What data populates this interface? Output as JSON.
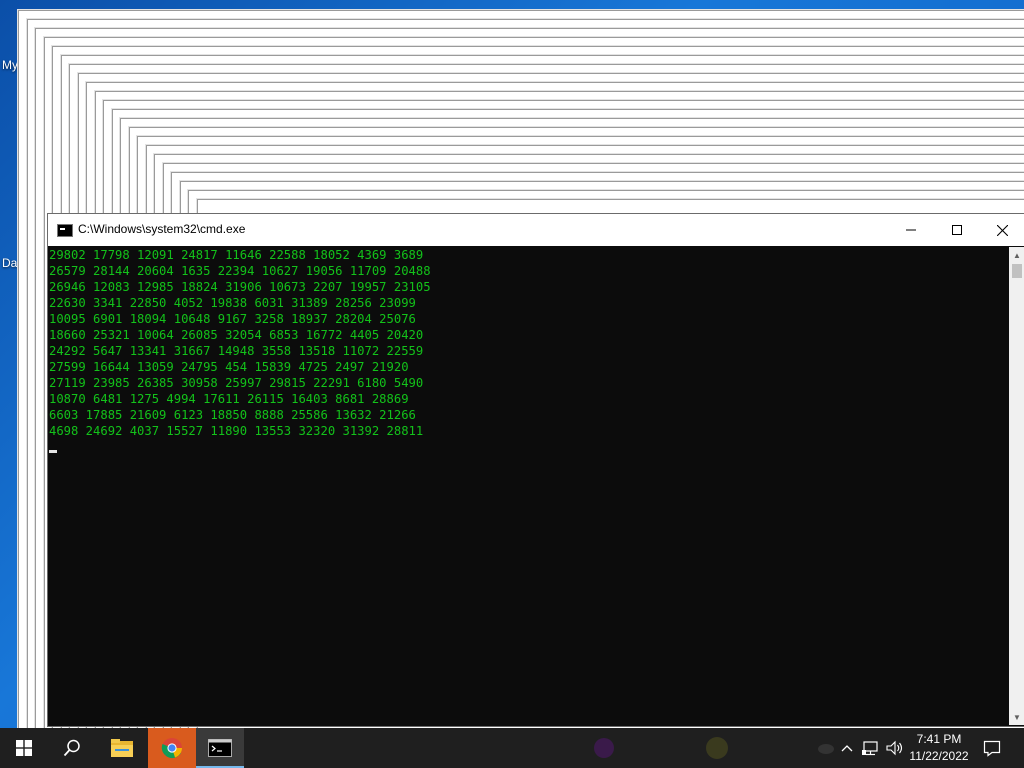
{
  "desktop": {
    "icon_labels": [
      "My",
      "Da"
    ]
  },
  "cmd_window": {
    "title": "C:\\Windows\\system32\\cmd.exe",
    "minimize_icon": "minimize-icon",
    "maximize_icon": "maximize-icon",
    "close_icon": "close-icon",
    "output_lines": [
      "29802 17798 12091 24817 11646 22588 18052 4369 3689",
      "26579 28144 20604 1635 22394 10627 19056 11709 20488",
      "26946 12083 12985 18824 31906 10673 2207 19957 23105",
      "22630 3341 22850 4052 19838 6031 31389 28256 23099",
      "10095 6901 18094 10648 9167 3258 18937 28204 25076",
      "18660 25321 10064 26085 32054 6853 16772 4405 20420",
      "24292 5647 13341 31667 14948 3558 13518 11072 22559",
      "27599 16644 13059 24795 454 15839 4725 2497 21920",
      "27119 23985 26385 30958 25997 29815 22291 6180 5490",
      "10870 6481 1275 4994 17611 26115 16403 8681 28869",
      "6603 17885 21609 6123 18850 8888 25586 13632 21266",
      "4698 24692 4037 15527 11890 13553 32320 31392 28811"
    ],
    "text_color": "#13c21a"
  },
  "taskbar": {
    "start_icon": "windows-start-icon",
    "search_icon": "search-icon",
    "apps": [
      "file-explorer-icon",
      "chrome-icon",
      "cmd-icon"
    ],
    "clock_time": "7:41 PM",
    "clock_date": "11/22/2022"
  }
}
